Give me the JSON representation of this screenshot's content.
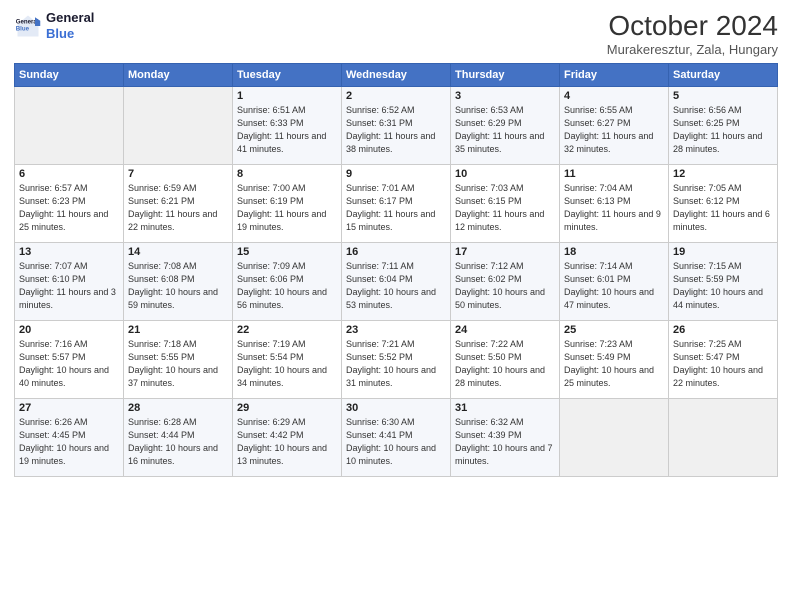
{
  "header": {
    "logo_line1": "General",
    "logo_line2": "Blue",
    "month": "October 2024",
    "location": "Murakeresztur, Zala, Hungary"
  },
  "weekdays": [
    "Sunday",
    "Monday",
    "Tuesday",
    "Wednesday",
    "Thursday",
    "Friday",
    "Saturday"
  ],
  "weeks": [
    [
      {
        "day": "",
        "detail": ""
      },
      {
        "day": "",
        "detail": ""
      },
      {
        "day": "1",
        "detail": "Sunrise: 6:51 AM\nSunset: 6:33 PM\nDaylight: 11 hours and 41 minutes."
      },
      {
        "day": "2",
        "detail": "Sunrise: 6:52 AM\nSunset: 6:31 PM\nDaylight: 11 hours and 38 minutes."
      },
      {
        "day": "3",
        "detail": "Sunrise: 6:53 AM\nSunset: 6:29 PM\nDaylight: 11 hours and 35 minutes."
      },
      {
        "day": "4",
        "detail": "Sunrise: 6:55 AM\nSunset: 6:27 PM\nDaylight: 11 hours and 32 minutes."
      },
      {
        "day": "5",
        "detail": "Sunrise: 6:56 AM\nSunset: 6:25 PM\nDaylight: 11 hours and 28 minutes."
      }
    ],
    [
      {
        "day": "6",
        "detail": "Sunrise: 6:57 AM\nSunset: 6:23 PM\nDaylight: 11 hours and 25 minutes."
      },
      {
        "day": "7",
        "detail": "Sunrise: 6:59 AM\nSunset: 6:21 PM\nDaylight: 11 hours and 22 minutes."
      },
      {
        "day": "8",
        "detail": "Sunrise: 7:00 AM\nSunset: 6:19 PM\nDaylight: 11 hours and 19 minutes."
      },
      {
        "day": "9",
        "detail": "Sunrise: 7:01 AM\nSunset: 6:17 PM\nDaylight: 11 hours and 15 minutes."
      },
      {
        "day": "10",
        "detail": "Sunrise: 7:03 AM\nSunset: 6:15 PM\nDaylight: 11 hours and 12 minutes."
      },
      {
        "day": "11",
        "detail": "Sunrise: 7:04 AM\nSunset: 6:13 PM\nDaylight: 11 hours and 9 minutes."
      },
      {
        "day": "12",
        "detail": "Sunrise: 7:05 AM\nSunset: 6:12 PM\nDaylight: 11 hours and 6 minutes."
      }
    ],
    [
      {
        "day": "13",
        "detail": "Sunrise: 7:07 AM\nSunset: 6:10 PM\nDaylight: 11 hours and 3 minutes."
      },
      {
        "day": "14",
        "detail": "Sunrise: 7:08 AM\nSunset: 6:08 PM\nDaylight: 10 hours and 59 minutes."
      },
      {
        "day": "15",
        "detail": "Sunrise: 7:09 AM\nSunset: 6:06 PM\nDaylight: 10 hours and 56 minutes."
      },
      {
        "day": "16",
        "detail": "Sunrise: 7:11 AM\nSunset: 6:04 PM\nDaylight: 10 hours and 53 minutes."
      },
      {
        "day": "17",
        "detail": "Sunrise: 7:12 AM\nSunset: 6:02 PM\nDaylight: 10 hours and 50 minutes."
      },
      {
        "day": "18",
        "detail": "Sunrise: 7:14 AM\nSunset: 6:01 PM\nDaylight: 10 hours and 47 minutes."
      },
      {
        "day": "19",
        "detail": "Sunrise: 7:15 AM\nSunset: 5:59 PM\nDaylight: 10 hours and 44 minutes."
      }
    ],
    [
      {
        "day": "20",
        "detail": "Sunrise: 7:16 AM\nSunset: 5:57 PM\nDaylight: 10 hours and 40 minutes."
      },
      {
        "day": "21",
        "detail": "Sunrise: 7:18 AM\nSunset: 5:55 PM\nDaylight: 10 hours and 37 minutes."
      },
      {
        "day": "22",
        "detail": "Sunrise: 7:19 AM\nSunset: 5:54 PM\nDaylight: 10 hours and 34 minutes."
      },
      {
        "day": "23",
        "detail": "Sunrise: 7:21 AM\nSunset: 5:52 PM\nDaylight: 10 hours and 31 minutes."
      },
      {
        "day": "24",
        "detail": "Sunrise: 7:22 AM\nSunset: 5:50 PM\nDaylight: 10 hours and 28 minutes."
      },
      {
        "day": "25",
        "detail": "Sunrise: 7:23 AM\nSunset: 5:49 PM\nDaylight: 10 hours and 25 minutes."
      },
      {
        "day": "26",
        "detail": "Sunrise: 7:25 AM\nSunset: 5:47 PM\nDaylight: 10 hours and 22 minutes."
      }
    ],
    [
      {
        "day": "27",
        "detail": "Sunrise: 6:26 AM\nSunset: 4:45 PM\nDaylight: 10 hours and 19 minutes."
      },
      {
        "day": "28",
        "detail": "Sunrise: 6:28 AM\nSunset: 4:44 PM\nDaylight: 10 hours and 16 minutes."
      },
      {
        "day": "29",
        "detail": "Sunrise: 6:29 AM\nSunset: 4:42 PM\nDaylight: 10 hours and 13 minutes."
      },
      {
        "day": "30",
        "detail": "Sunrise: 6:30 AM\nSunset: 4:41 PM\nDaylight: 10 hours and 10 minutes."
      },
      {
        "day": "31",
        "detail": "Sunrise: 6:32 AM\nSunset: 4:39 PM\nDaylight: 10 hours and 7 minutes."
      },
      {
        "day": "",
        "detail": ""
      },
      {
        "day": "",
        "detail": ""
      }
    ]
  ]
}
